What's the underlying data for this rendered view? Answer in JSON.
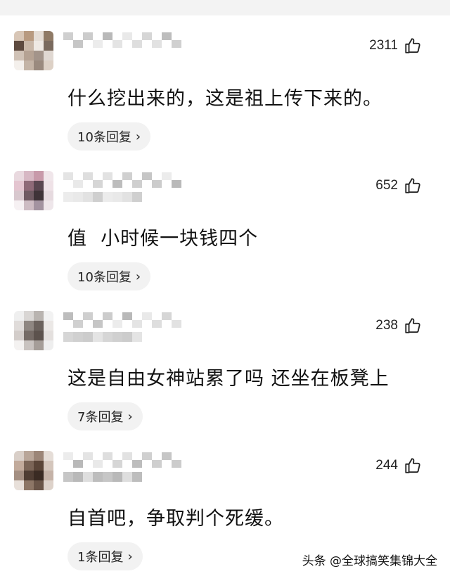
{
  "comments": [
    {
      "likes": "2311",
      "text": "什么挖出来的，这是祖上传下来的。",
      "reply_label": "10条回复",
      "avatar_colors": [
        "#d8c6b6",
        "#b89a80",
        "#e5ddd6",
        "#8f7a66",
        "#5e4a3f",
        "#c9b7a8",
        "#efe9e4",
        "#7a6a5e",
        "#d0c2b6",
        "#b5a293",
        "#a3948a",
        "#e0d8d2",
        "#f4f0ec",
        "#c4b4a6",
        "#9a8a7e",
        "#ddd1c6"
      ]
    },
    {
      "likes": "652",
      "text": "值  小时候一块钱四个",
      "reply_label": "10条回复",
      "avatar_colors": [
        "#e9d9df",
        "#d7b8c4",
        "#c89aaa",
        "#f0e6ea",
        "#e4c5d0",
        "#8f6a78",
        "#5a4650",
        "#efe2e7",
        "#d8c8ce",
        "#6f5a62",
        "#3f3338",
        "#e6dadf",
        "#f6f1f3",
        "#cdbcc3",
        "#a393a0",
        "#eee6ea"
      ]
    },
    {
      "likes": "238",
      "text": "这是自由女神站累了吗 还坐在板凳上",
      "reply_label": "7条回复",
      "avatar_colors": [
        "#efefef",
        "#d9d6d4",
        "#b9b4b0",
        "#f2f2f2",
        "#e0dcda",
        "#8f8782",
        "#6b625d",
        "#ebe8e6",
        "#d3cdca",
        "#756b66",
        "#5c524d",
        "#e4e0de",
        "#f4f2f1",
        "#c9c3c0",
        "#a59d98",
        "#eeeeee"
      ]
    },
    {
      "likes": "244",
      "text": "自首吧，争取判个死缓。",
      "reply_label": "1条回复",
      "avatar_colors": [
        "#d9cfc8",
        "#b9a699",
        "#9c8678",
        "#e5ddd7",
        "#c2ab9c",
        "#7b6557",
        "#5a4538",
        "#d4c6bc",
        "#a48f82",
        "#4f3d33",
        "#3a2b23",
        "#c5b3a8",
        "#e8e0da",
        "#8d7666",
        "#6a5548",
        "#ddd2ca"
      ]
    }
  ],
  "watermark": "头条 @全球搞笑集锦大全"
}
